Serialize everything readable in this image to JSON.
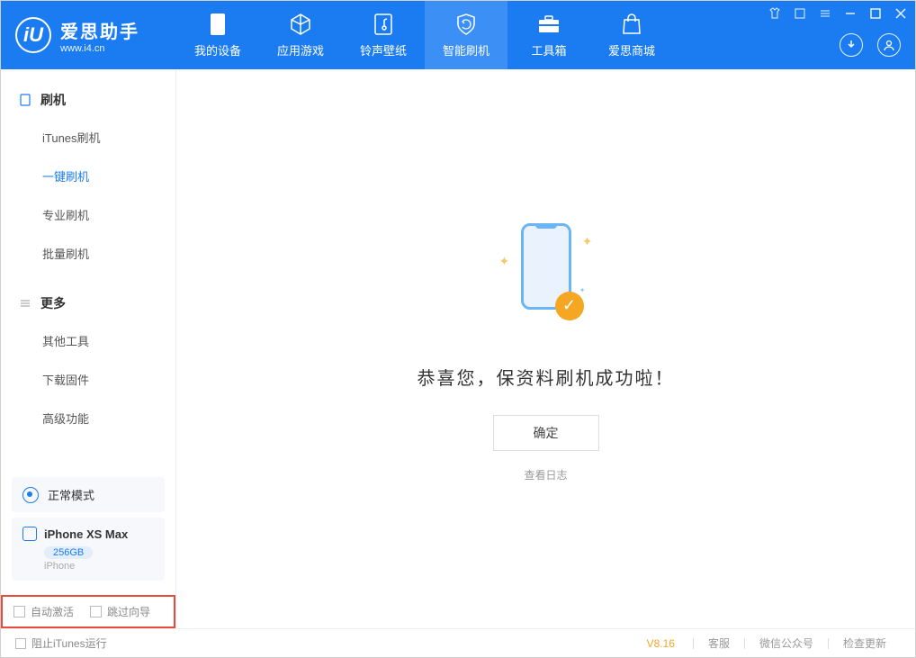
{
  "app": {
    "title": "爱思助手",
    "subtitle": "www.i4.cn"
  },
  "nav": {
    "tabs": [
      {
        "label": "我的设备"
      },
      {
        "label": "应用游戏"
      },
      {
        "label": "铃声壁纸"
      },
      {
        "label": "智能刷机"
      },
      {
        "label": "工具箱"
      },
      {
        "label": "爱思商城"
      }
    ]
  },
  "sidebar": {
    "section1": {
      "title": "刷机",
      "items": [
        {
          "label": "iTunes刷机"
        },
        {
          "label": "一键刷机"
        },
        {
          "label": "专业刷机"
        },
        {
          "label": "批量刷机"
        }
      ]
    },
    "section2": {
      "title": "更多",
      "items": [
        {
          "label": "其他工具"
        },
        {
          "label": "下载固件"
        },
        {
          "label": "高级功能"
        }
      ]
    },
    "status": "正常模式",
    "device": {
      "name": "iPhone XS Max",
      "storage": "256GB",
      "type": "iPhone"
    },
    "checkboxes": {
      "auto_activate": "自动激活",
      "skip_guide": "跳过向导"
    }
  },
  "content": {
    "title": "恭喜您，保资料刷机成功啦！",
    "ok_button": "确定",
    "view_log": "查看日志"
  },
  "footer": {
    "block_itunes": "阻止iTunes运行",
    "version": "V8.16",
    "links": {
      "support": "客服",
      "wechat": "微信公众号",
      "update": "检查更新"
    }
  }
}
